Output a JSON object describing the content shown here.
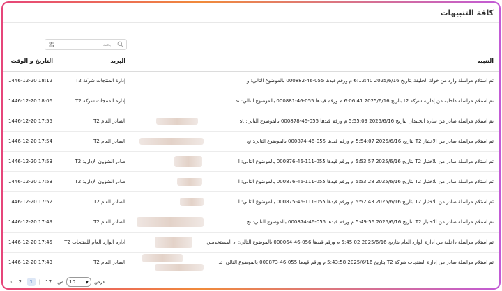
{
  "page": {
    "title": "كافة التنبيهات"
  },
  "search": {
    "placeholder": "بحث"
  },
  "table": {
    "headers": {
      "notification": "التنبيه",
      "mail": "البريد",
      "datetime": "التاريخ و الوقت"
    },
    "rows": [
      {
        "text": "تم استلام مراسلة وارد من خولة الخليفة بتاريخ 2025/6/16 6:12:40 م ورقم قيدها 055-46-000882 بالموضوع التالي: و",
        "mail": "إدارة المنتجات شركة T2",
        "date": "1446-12-20 18:12"
      },
      {
        "text": "تم استلام مراسلة داخلية من إدارية شركة t2 بتاريخ 2025/6/16 6:06:41 م ورقم قيدها 055-46-000881 بالموضوع التالي: تد",
        "mail": "إدارة المنتجات شركة T2",
        "date": "1446-12-20 18:06"
      },
      {
        "text": "تم استلام مراسلة صادر من ساره الجليدان بتاريخ 2025/6/16 5:55:09 م ورقم قيدها 055-46-000878 بالموضوع التالي: st",
        "mail": "الصادر العام T2",
        "date": "1446-12-20 17:55"
      },
      {
        "text": "تم استلام مراسلة صادر من الاختبار T2 بتاريخ 2025/6/16 5:54:07 م ورقم قيدها 055-46-000874 بالموضوع التالي: تج",
        "mail": "الصادر العام T2",
        "date": "1446-12-20 17:54"
      },
      {
        "text": "تم استلام مراسلة صادر من للاختبار T2 بتاريخ 2025/6/16 5:53:57 م ورقم قيدها 055-111-46-000876 بالموضوع التالي: ا",
        "mail": "صادر الشؤون الإدارية T2",
        "date": "1446-12-20 17:53"
      },
      {
        "text": "تم استلام مراسلة صادر من للاختبار T2 بتاريخ 2025/6/16 5:53:28 م ورقم قيدها 055-111-46-000876 بالموضوع التالي: ا",
        "mail": "صادر الشؤون الإدارية T2",
        "date": "1446-12-20 17:53"
      },
      {
        "text": "تم استلام مراسلة صادر من للاختبار T2 بتاريخ 2025/6/16 5:52:43 م ورقم قيدها 055-111-46-000875 بالموضوع التالي: ا",
        "mail": "الصادر العام T2",
        "date": "1446-12-20 17:52"
      },
      {
        "text": "تم استلام مراسلة صادر من الاختبار T2 بتاريخ 2025/6/16 5:49:56 م ورقم قيدها 055-46-000874 بالموضوع التالي: تج",
        "mail": "الصادر العام T2",
        "date": "1446-12-20 17:49"
      },
      {
        "text": "تم استلام مراسلة داخلية من ادارة الوارد العام بتاريخ 2025/6/16 5:45:02 م ورقم قيدها 056-46-000064 بالموضوع التالي: اد المستخدمين",
        "mail": "اداره الوارد العام للمنتجات T2",
        "date": "1446-12-20 17:45"
      },
      {
        "text": "تم استلام مراسلة صادر من إدارة المنتجات شركة T2 بتاريخ 2025/6/16 5:43:58 م ورقم قيدها 055-46-000873 بالموضوع التالي: تد",
        "mail": "الصادر العام T2",
        "date": "1446-12-20 17:43"
      }
    ]
  },
  "pagination": {
    "show_label": "عرض",
    "page_size": "10",
    "of_label": "من",
    "total_pages": "17",
    "pages": [
      "1",
      "2"
    ],
    "current": "1"
  }
}
